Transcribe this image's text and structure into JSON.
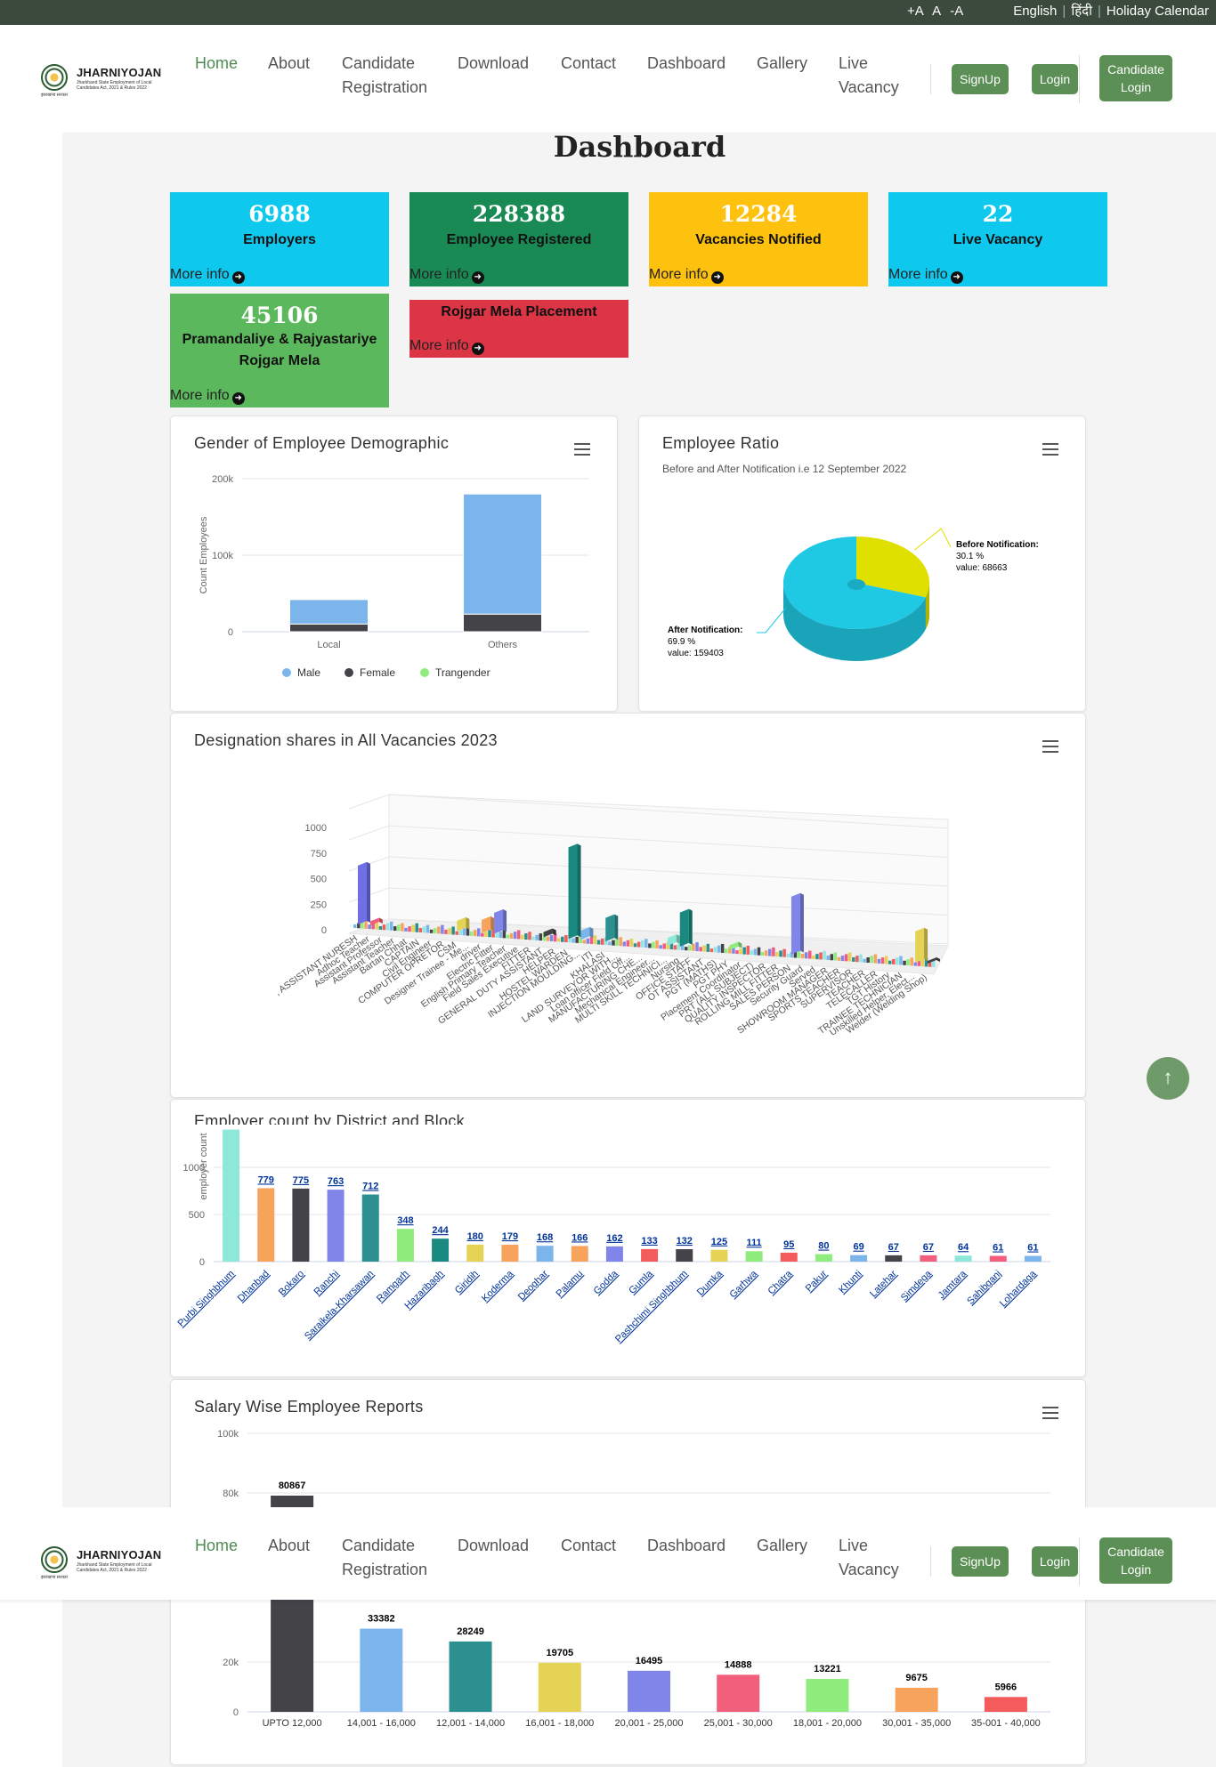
{
  "topbar": {
    "font_controls": [
      "+A",
      "A",
      "-A"
    ],
    "lang_english": "English",
    "lang_hindi": "हिंदी",
    "holiday": "Holiday Calendar"
  },
  "logo": {
    "name": "JHARNIYOJAN",
    "tagline": "Jharkhand State Employment of Local Candidates Act, 2021 & Rules 2022",
    "sub": "झारखण्ड सरकार"
  },
  "nav": {
    "home": "Home",
    "about": "About",
    "candidate_reg_1": "Candidate",
    "candidate_reg_2": "Registration",
    "download": "Download",
    "contact": "Contact",
    "dashboard": "Dashboard",
    "gallery": "Gallery",
    "live_1": "Live",
    "live_2": "Vacancy",
    "signup": "SignUp",
    "login": "Login",
    "cand_login_1": "Candidate",
    "cand_login_2": "Login"
  },
  "page_title": "Dashboard",
  "more_info": "More info",
  "stats": [
    {
      "value": "6988",
      "label": "Employers",
      "color": "#0ec8ee"
    },
    {
      "value": "228388",
      "label": "Employee Registered",
      "color": "#1a8a55"
    },
    {
      "value": "12284",
      "label": "Vacancies Notified",
      "color": "#fec10d"
    },
    {
      "value": "22",
      "label": "Live Vacancy",
      "color": "#0ec8ee"
    },
    {
      "value": "45106",
      "label": "Pramandaliye & Rajyastariye Rojgar Mela",
      "color": "#5cb85c"
    },
    {
      "value": "",
      "label": "Rojgar Mela Placement",
      "color": "#dc3545"
    }
  ],
  "colors": {
    "male": "#7cb5ec",
    "female": "#434348",
    "transgender": "#90ed7d"
  },
  "charts": {
    "gender": {
      "title": "Gender of Employee Demographic",
      "chart_data": {
        "type": "bar",
        "stacked": true,
        "categories": [
          "Local",
          "Others"
        ],
        "ylabel": "Count Employees",
        "ylim": [
          0,
          200000
        ],
        "yticks": [
          "0",
          "100k",
          "200k"
        ],
        "series": [
          {
            "name": "Male",
            "values": [
              32000,
              157000
            ]
          },
          {
            "name": "Female",
            "values": [
              10000,
              23000
            ]
          },
          {
            "name": "Trangender",
            "values": [
              0,
              0
            ]
          }
        ],
        "legend": "bottom"
      }
    },
    "ratio": {
      "title": "Employee Ratio",
      "subtitle": "Before and After Notification i.e 12 September 2022",
      "chart_data": {
        "type": "pie",
        "slices": [
          {
            "name": "Before Notification",
            "percent": "30.1 %",
            "value": 68663,
            "value_label": "value: 68663",
            "color": "#dfdf00"
          },
          {
            "name": "After Notification",
            "percent": "69.9 %",
            "value": 159403,
            "value_label": "value: 159403",
            "color": "#1fc8e3"
          }
        ]
      }
    },
    "designation": {
      "title": "Designation shares in All Vacancies 2023",
      "chart_data": {
        "type": "bar",
        "yticks": [
          "0",
          "250",
          "500",
          "750",
          "1000"
        ],
        "ylim": [
          0,
          1000
        ],
        "categories": [
          ", ASSISTANT NURESH",
          "Adhoc Teacher",
          "Assistant Professor",
          "Assistant Teacher",
          "Bartan Chhat",
          "CAPTAIN",
          "Civil Engineer",
          "COMPUTER OPRETOR",
          "CSM",
          "Designer Trainee - Me...",
          "driver",
          "Electric Fitter",
          "English Primary Teacher",
          "Field Sales Executive",
          "FITTER",
          "GENERAL DUTY ASSISTANT",
          "HELPER",
          "HOSTEL WARDEN",
          "INJECTION MOULDING...",
          "ITI",
          "KHALASI",
          "LAND SURVEYOR WITH...",
          "Loan officer Field Off...",
          "MANUFACTURING CHE...",
          "Mechanical Engineer...",
          "MULTI SKILL TECHNICI...",
          "Nursing",
          "OFFICE STAFF",
          "OT ASSISTANT",
          "PGT (MATHS)",
          "PGT PHY",
          "Placement Coordinator",
          "PRT (ALL SUBJECT)",
          "QUALITY INSPECTOR",
          "ROLLING MILL FITTER",
          "SALES PERSON",
          "Security Guard",
          "Served",
          "SHOWROOM MANAGER",
          "SPORTS TEACHER",
          "SUPERVISOR",
          "TEACHER",
          "TELECALLER",
          "TGT History",
          "TRAINEE TECHNICIAN",
          "Unskilled Helper, Elect...",
          "Welder (Welding Shop)"
        ],
        "peaks": [
          {
            "category": ", ASSISTANT NURESH",
            "value": 450,
            "color": "#6f6fe6"
          },
          {
            "category": "Adhoc Teacher",
            "value": 30,
            "color": "#f25f7c"
          },
          {
            "category": "CSM",
            "value": 80,
            "color": "#e4d354"
          },
          {
            "category": "driver",
            "value": 100,
            "color": "#f7a35c"
          },
          {
            "category": "Electric Fitter",
            "value": 160,
            "color": "#8085e9"
          },
          {
            "category": "GENERAL DUTY ASSISTANT",
            "value": 40,
            "color": "#434348"
          },
          {
            "category": "HOSTEL WARDEN",
            "value": 700,
            "color": "#1a8a80"
          },
          {
            "category": "INJECTION MOULDING...",
            "value": 70,
            "color": "#7cb5ec"
          },
          {
            "category": "KHALASI",
            "value": 180,
            "color": "#2b908f"
          },
          {
            "category": "MULTI SKILL TECHNICI...",
            "value": 60,
            "color": "#8ce8d8"
          },
          {
            "category": "Nursing",
            "value": 260,
            "color": "#1a8a80"
          },
          {
            "category": "PGT PHY",
            "value": 35,
            "color": "#90ed7d"
          },
          {
            "category": "SALES PERSON",
            "value": 440,
            "color": "#8085e9"
          },
          {
            "category": "Unskilled Helper, Elect...",
            "value": 240,
            "color": "#e4d354"
          },
          {
            "category": "Welder (Welding Shop)",
            "value": 20,
            "color": "#434348"
          }
        ]
      }
    },
    "district": {
      "title": "Employer count by District and Block",
      "chart_data": {
        "type": "bar",
        "ylabel": "employer count",
        "ylim": [
          0,
          1400
        ],
        "yticks": [
          "0",
          "500",
          "1000"
        ],
        "categories": [
          "Purbi Singhbhum",
          "Dhanbad",
          "Bokaro",
          "Ranchi",
          "Saraikela-Kharsawan",
          "Ramgarh",
          "Hazaribagh",
          "Giridih",
          "Koderma",
          "Deoghar",
          "Palamu",
          "Godda",
          "Gumla",
          "Pashchimi Singhbhum",
          "Dumka",
          "Garhwa",
          "Chatra",
          "Pakur",
          "Khunti",
          "Latehar",
          "Simdega",
          "Jamtara",
          "Sahibganj",
          "Lohardaga"
        ],
        "values": [
          1400,
          779,
          775,
          763,
          712,
          348,
          244,
          180,
          179,
          168,
          166,
          162,
          133,
          132,
          125,
          111,
          95,
          80,
          69,
          67,
          67,
          64,
          61,
          61
        ],
        "value_labels": [
          "",
          "779",
          "775",
          "763",
          "712",
          "348",
          "244",
          "180",
          "179",
          "168",
          "166",
          "162",
          "133",
          "132",
          "125",
          "111",
          "95",
          "80",
          "69",
          "67",
          "67",
          "64",
          "61",
          "61"
        ],
        "colors": [
          "#8ce8d8",
          "#f7a35c",
          "#434348",
          "#8085e9",
          "#2b908f",
          "#90ed7d",
          "#1a8a80",
          "#e4d354",
          "#f7a35c",
          "#7cb5ec",
          "#f7a35c",
          "#8085e9",
          "#f45b5b",
          "#434348",
          "#e4d354",
          "#90ed7d",
          "#f45b5b",
          "#90ed7d",
          "#7cb5ec",
          "#434348",
          "#f25f7c",
          "#8ce8d8",
          "#f25f7c",
          "#7cb5ec"
        ]
      }
    },
    "salary": {
      "title": "Salary Wise Employee Reports",
      "chart_data": {
        "type": "bar",
        "ylim": [
          0,
          100000
        ],
        "yticks": [
          "0",
          "20k",
          "80k",
          "100k"
        ],
        "categories": [
          "UPTO 12,000",
          "14,001 - 16,000",
          "12,001 - 14,000",
          "16,001 - 18,000",
          "20,001 - 25,000",
          "25,001 - 30,000",
          "18,001 - 20,000",
          "30,001 - 35,000",
          "35-001 - 40,000"
        ],
        "values": [
          80867,
          33382,
          28249,
          19705,
          16495,
          14888,
          13221,
          9675,
          5966
        ],
        "value_labels": [
          "80867",
          "33382",
          "28249",
          "19705",
          "16495",
          "14888",
          "13221",
          "9675",
          "5966"
        ],
        "colors": [
          "#434348",
          "#7cb5ec",
          "#2b908f",
          "#e4d354",
          "#8085e9",
          "#f25f7c",
          "#90ed7d",
          "#f7a35c",
          "#f45b5b"
        ]
      }
    }
  }
}
